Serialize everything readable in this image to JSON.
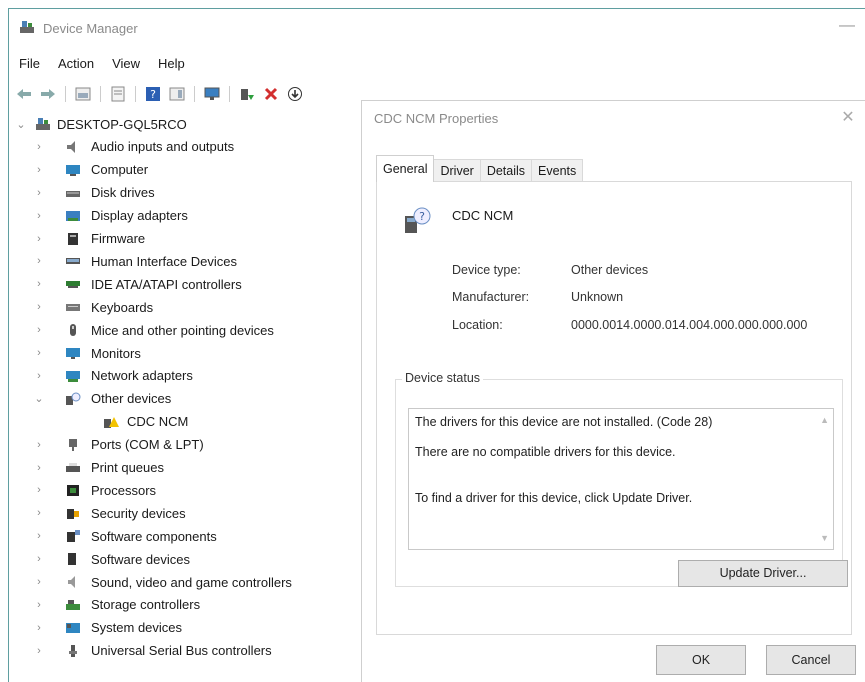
{
  "window": {
    "title": "Device Manager",
    "minimize": "—"
  },
  "menu": [
    "File",
    "Action",
    "View",
    "Help"
  ],
  "toolbar": [
    "back-arrow-icon",
    "forward-arrow-icon",
    "properties-grid-icon",
    "document-icon",
    "help-icon",
    "panel-icon",
    "monitor-icon",
    "enable-device-icon",
    "uninstall-x-icon",
    "update-driver-icon"
  ],
  "tree": {
    "root": "DESKTOP-GQL5RCO",
    "items": [
      {
        "label": "Audio inputs and outputs",
        "icon": "speaker-icon",
        "expanded": false
      },
      {
        "label": "Computer",
        "icon": "computer-icon",
        "expanded": false
      },
      {
        "label": "Disk drives",
        "icon": "disk-drive-icon",
        "expanded": false
      },
      {
        "label": "Display adapters",
        "icon": "display-adapter-icon",
        "expanded": false
      },
      {
        "label": "Firmware",
        "icon": "firmware-icon",
        "expanded": false
      },
      {
        "label": "Human Interface Devices",
        "icon": "hid-icon",
        "expanded": false
      },
      {
        "label": "IDE ATA/ATAPI controllers",
        "icon": "ide-controller-icon",
        "expanded": false
      },
      {
        "label": "Keyboards",
        "icon": "keyboard-icon",
        "expanded": false
      },
      {
        "label": "Mice and other pointing devices",
        "icon": "mouse-icon",
        "expanded": false
      },
      {
        "label": "Monitors",
        "icon": "monitor-icon",
        "expanded": false
      },
      {
        "label": "Network adapters",
        "icon": "network-adapter-icon",
        "expanded": false
      },
      {
        "label": "Other devices",
        "icon": "unknown-device-icon",
        "expanded": true
      },
      {
        "label": "Ports (COM & LPT)",
        "icon": "port-icon",
        "expanded": false
      },
      {
        "label": "Print queues",
        "icon": "printer-icon",
        "expanded": false
      },
      {
        "label": "Processors",
        "icon": "processor-icon",
        "expanded": false
      },
      {
        "label": "Security devices",
        "icon": "security-device-icon",
        "expanded": false
      },
      {
        "label": "Software components",
        "icon": "software-component-icon",
        "expanded": false
      },
      {
        "label": "Software devices",
        "icon": "software-device-icon",
        "expanded": false
      },
      {
        "label": "Sound, video and game controllers",
        "icon": "sound-controller-icon",
        "expanded": false
      },
      {
        "label": "Storage controllers",
        "icon": "storage-controller-icon",
        "expanded": false
      },
      {
        "label": "System devices",
        "icon": "system-device-icon",
        "expanded": false
      },
      {
        "label": "Universal Serial Bus controllers",
        "icon": "usb-icon",
        "expanded": false
      }
    ],
    "child": {
      "label": "CDC NCM",
      "icon": "warning-device-icon",
      "parent": "Other devices"
    }
  },
  "dialog": {
    "title": "CDC NCM Properties",
    "close": "✕",
    "tabs": [
      "General",
      "Driver",
      "Details",
      "Events"
    ],
    "active_tab": "General",
    "device_name": "CDC NCM",
    "props": [
      {
        "label": "Device type:",
        "value": "Other devices"
      },
      {
        "label": "Manufacturer:",
        "value": "Unknown"
      },
      {
        "label": "Location:",
        "value": "0000.0014.0000.014.004.000.000.000.000"
      }
    ],
    "status_group": "Device status",
    "status_lines": [
      "The drivers for this device are not installed. (Code 28)",
      "There are no compatible drivers for this device.",
      "To find a driver for this device, click Update Driver."
    ],
    "update_button": "Update Driver...",
    "ok_button": "OK",
    "cancel_button": "Cancel"
  },
  "colors": {
    "accent": "#5f9ea0",
    "error_red": "#d32f2f",
    "folder_blue": "#2e86c1"
  }
}
